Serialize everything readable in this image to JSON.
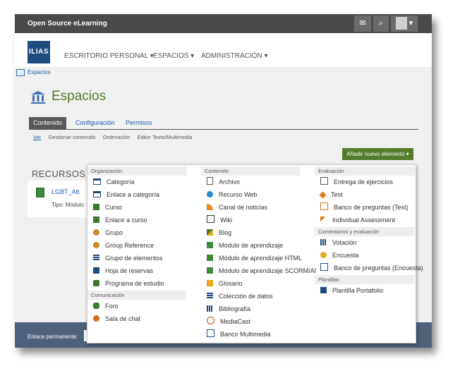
{
  "app": {
    "brand": "Open Source eLearning",
    "logo": "ILIAS",
    "nav": [
      "ESCRITORIO PERSONAL ▾",
      "ESPACIOS ▾",
      "ADMINISTRACIÓN ▾"
    ],
    "top_icons": [
      "mail-icon",
      "search-icon",
      "user-avatar-icon"
    ]
  },
  "breadcrumb": "Espacios",
  "page_title": "Espacios",
  "tabs": [
    "Contenido",
    "Configuración",
    "Permisos"
  ],
  "subtabs": [
    "Ver",
    "Gestionar contenido",
    "Ordenación",
    "Editor Texto/Multimedia"
  ],
  "add_button": "Añadir nuevo elemento ▾",
  "section_heading": "RECURSOS DE",
  "resource": {
    "name": "LGBT_Att",
    "type": "Tipo: Módulo"
  },
  "footer_label": "Enlace permanente:",
  "colors": {
    "green": "#557b2d",
    "dark": "#4a4a4a",
    "footer": "#4f607a",
    "link": "#1e5da8"
  },
  "menu": {
    "col1": {
      "headers": [
        "Organización",
        "Comunicación"
      ],
      "org_items": [
        "Categoría",
        "Enlace a categoría",
        "Curso",
        "Enlace a curso",
        "Grupo",
        "Group Reference",
        "Grupo de elementos",
        "Hoja de reservas",
        "Programa de estudio"
      ],
      "com_items": [
        "Foro",
        "Sala de chat"
      ]
    },
    "col2": {
      "header": "Contenido",
      "items": [
        "Archivo",
        "Recurso Web",
        "Canal de noticias",
        "Wiki",
        "Blog",
        "Módulo de aprendizaje",
        "Módulo de aprendizaje HTML",
        "Módulo de aprendizaje SCORM/AI",
        "Glosario",
        "Colección de datos",
        "Bibliografía",
        "MediaCast",
        "Banco Multimedia"
      ]
    },
    "col3": {
      "headers": [
        "Evaluación",
        "Comentarios y evaluación",
        "Plantillas"
      ],
      "eval_items": [
        "Entrega de ejercicios",
        "Test",
        "Banco de preguntas (Test)",
        "Individual Assessment"
      ],
      "fb_items": [
        "Votación",
        "Encuesta",
        "Banco de preguntas (Encuesta)"
      ],
      "tpl_items": [
        "Plantilla Portafolio"
      ]
    }
  }
}
